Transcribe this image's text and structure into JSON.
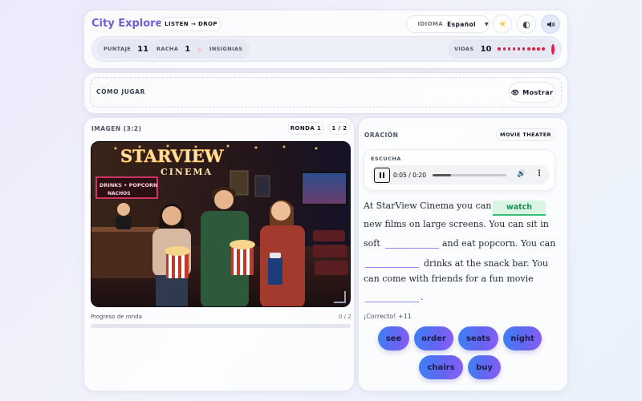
{
  "header": {
    "title": "City Explorer",
    "mode": "LISTEN → DROP",
    "language_label": "IDIOMA",
    "language_value": "Español",
    "icons": [
      "sun-icon",
      "contrast-icon",
      "speaker-icon"
    ]
  },
  "stats": {
    "score_label": "PUNTAJE",
    "score": "11",
    "streak_label": "RACHA",
    "streak": "1",
    "badges_label": "INSIGNIAS",
    "lives_label": "VIDAS",
    "lives": "10"
  },
  "howto": {
    "title": "CÓMO JUGAR",
    "show_button": "Mostrar"
  },
  "image_panel": {
    "label": "IMAGEN (3:2)",
    "round_label": "RONDA 1",
    "pager": "1 / 2",
    "photo_sign_main": "STARVIEW",
    "photo_sign_sub": "CINEMA",
    "photo_menu_1": "DRINKS • POPCORN",
    "photo_menu_2": "NACHOS",
    "progress_label": "Progreso de ronda",
    "progress_count": "0 / 2",
    "progress_fraction": 0
  },
  "sentence_panel": {
    "label": "ORACIÓN",
    "topic": "MOVIE THEATER",
    "listen_label": "ESCUCHA",
    "audio_time": "0:05 / 0:20",
    "audio_progress": 0.25,
    "lines": [
      "At StarView Cinema you can",
      "new films on large screens. You can sit in",
      "soft",
      "and eat popcorn. You can",
      "drinks at the snack bar. You",
      "can come with friends for a fun movie",
      "."
    ],
    "filled_word": "watch",
    "feedback": "¡Correcto! +11"
  },
  "word_bank": [
    "see",
    "order",
    "seats",
    "night",
    "chairs",
    "buy"
  ],
  "colors": {
    "accent": "#6a5fd6",
    "lives": "#e11d48",
    "correct": "#34c07a"
  }
}
